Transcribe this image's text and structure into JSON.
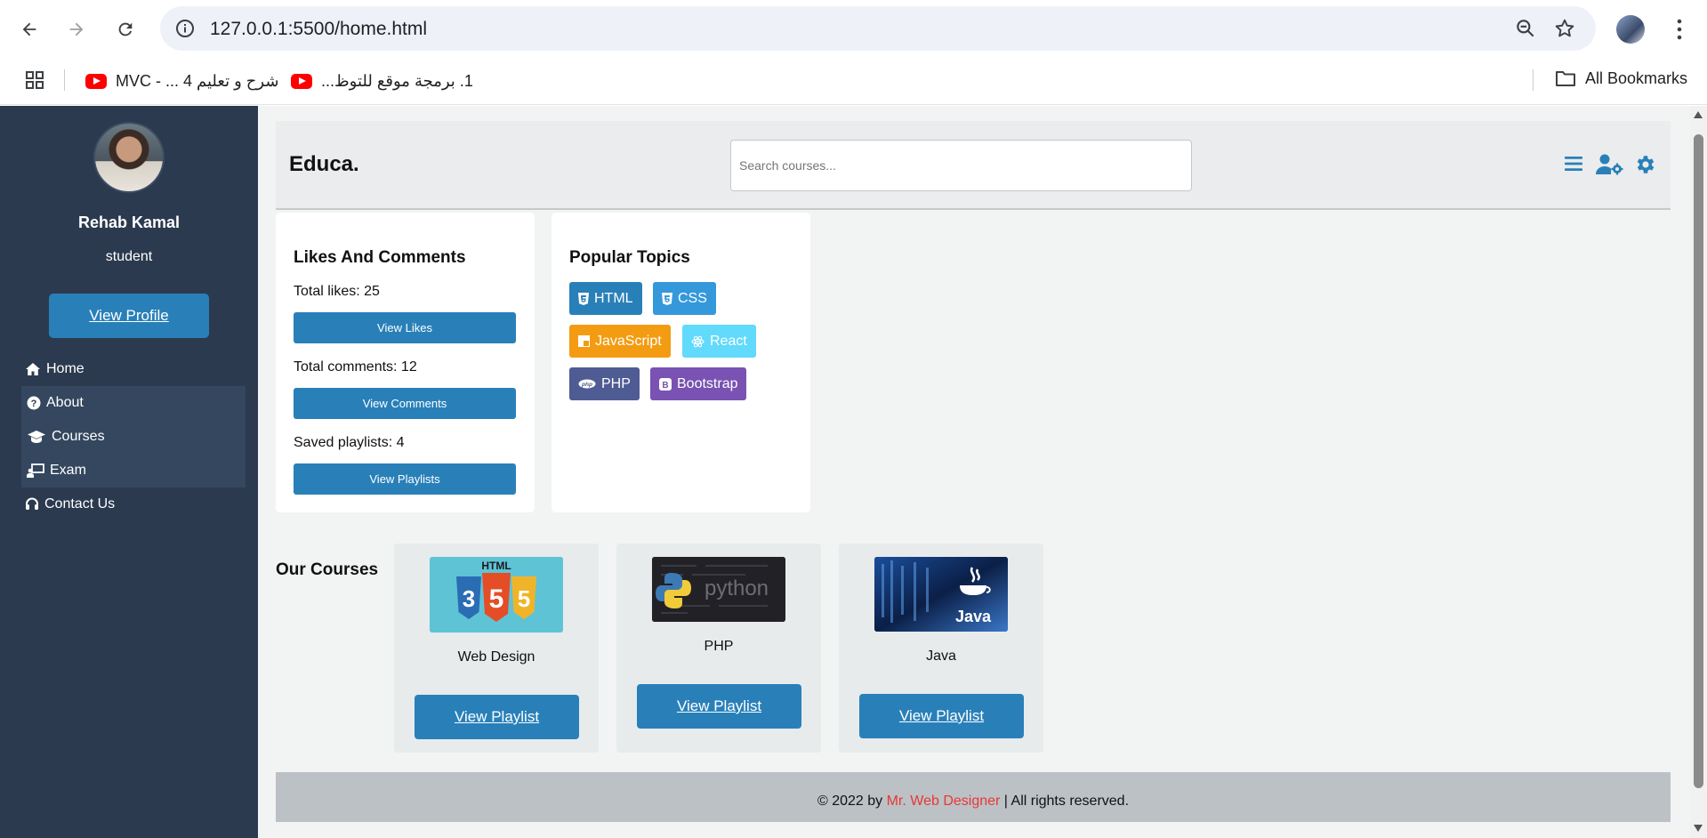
{
  "browser": {
    "url": "127.0.0.1:5500/home.html",
    "bookmarks": [
      {
        "label": "شرح و تعليم 4 ... - MVC",
        "icon": "youtube-icon"
      },
      {
        "label": "1. برمجة موقع للتوظ...",
        "icon": "youtube-icon"
      }
    ],
    "all_bookmarks": "All Bookmarks"
  },
  "sidebar": {
    "user_name": "Rehab Kamal",
    "user_role": "student",
    "view_profile": "View Profile",
    "menu": [
      {
        "label": "Home",
        "icon": "home-icon"
      },
      {
        "label": "About",
        "icon": "question-circle-icon"
      },
      {
        "label": "Courses",
        "icon": "graduation-cap-icon"
      },
      {
        "label": "Exam",
        "icon": "chalkboard-user-icon"
      },
      {
        "label": "Contact Us",
        "icon": "headset-icon"
      }
    ]
  },
  "header": {
    "brand": "Educa.",
    "search_placeholder": "Search courses...",
    "icons": [
      "menu-icon",
      "user-gear-icon",
      "gear-icon"
    ]
  },
  "likes_card": {
    "title": "Likes And Comments",
    "total_likes": "Total likes: 25",
    "view_likes": "View Likes",
    "total_comments": "Total comments: 12",
    "view_comments": "View Comments",
    "saved_playlists": "Saved playlists: 4",
    "view_playlists": "View Playlists"
  },
  "topics_card": {
    "title": "Popular Topics",
    "tags": [
      {
        "label": "HTML",
        "color": "#2980b9",
        "icon": "html5-icon"
      },
      {
        "label": "CSS",
        "color": "#3498db",
        "icon": "css3-icon"
      },
      {
        "label": "JavaScript",
        "color": "#f39c12",
        "icon": "js-icon"
      },
      {
        "label": "React",
        "color": "#61dafb",
        "icon": "react-icon"
      },
      {
        "label": "PHP",
        "color": "#4f5b93",
        "icon": "php-icon"
      },
      {
        "label": "Bootstrap",
        "color": "#7952b3",
        "icon": "bootstrap-icon"
      }
    ]
  },
  "courses": {
    "title": "Our Courses",
    "items": [
      {
        "name": "Web Design",
        "button": "View Playlist",
        "thumb_text": "HTML"
      },
      {
        "name": "PHP",
        "button": "View Playlist",
        "thumb_text": "python"
      },
      {
        "name": "Java",
        "button": "View Playlist",
        "thumb_text": "Java"
      }
    ]
  },
  "footer": {
    "prefix": "© 2022 by",
    "author": "Mr. Web Designer",
    "suffix": "| All rights reserved."
  },
  "colors": {
    "sidebar_bg": "#2b3a4f",
    "primary": "#2980b9",
    "footer_bg": "#bcc1c6",
    "author_red": "#e53935"
  }
}
